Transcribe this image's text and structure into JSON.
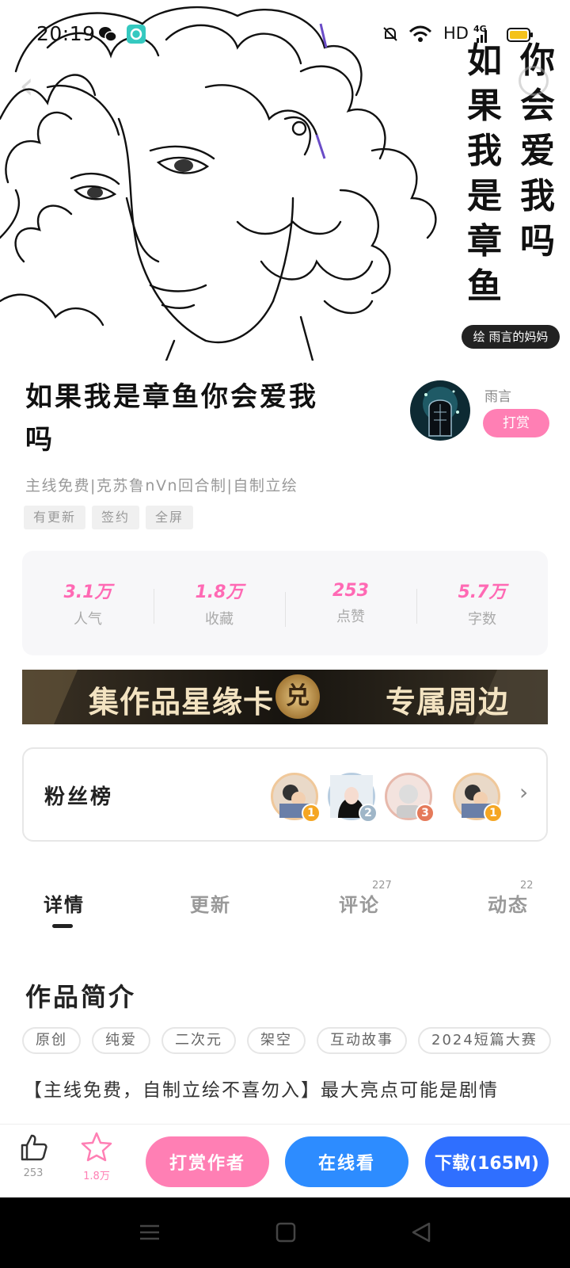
{
  "status_bar": {
    "time": "20:19",
    "network": "HD",
    "signal": "4G"
  },
  "cover": {
    "title_col_right": "你会爱我吗",
    "title_col_left": "如果我是章鱼",
    "author_tag": "绘 雨言的妈妈"
  },
  "book": {
    "title": "如果我是章鱼你会爱我吗",
    "subtitle": "主线免费|克苏鲁nVn回合制|自制立绘",
    "tags": [
      "有更新",
      "签约",
      "全屏"
    ]
  },
  "author": {
    "name": "雨言",
    "tip_label": "打赏"
  },
  "stats": [
    {
      "value": "3.1万",
      "label": "人气"
    },
    {
      "value": "1.8万",
      "label": "收藏"
    },
    {
      "value": "253",
      "label": "点赞"
    },
    {
      "value": "5.7万",
      "label": "字数"
    }
  ],
  "banner": {
    "text_left": "集作品星缘卡",
    "coin_label": "兑",
    "text_right": "专属周边"
  },
  "fans": {
    "title": "粉丝榜",
    "ranks": [
      "1",
      "2",
      "3",
      "1"
    ]
  },
  "tabs": [
    {
      "label": "详情",
      "count": ""
    },
    {
      "label": "更新",
      "count": ""
    },
    {
      "label": "评论",
      "count": "227"
    },
    {
      "label": "动态",
      "count": "22"
    }
  ],
  "intro": {
    "title": "作品简介",
    "chips": [
      "原创",
      "纯爱",
      "二次元",
      "架空",
      "互动故事",
      "2024短篇大赛"
    ],
    "text": "【主线免费，自制立绘不喜勿入】最大亮点可能是剧情"
  },
  "bottom_bar": {
    "like_count": "253",
    "fav_count": "1.8万",
    "tip_button": "打赏作者",
    "read_button": "在线看",
    "download_button": "下载(165M)"
  },
  "colors": {
    "accent_pink": "#ff7fb4",
    "accent_blue": "#2d8cff"
  }
}
